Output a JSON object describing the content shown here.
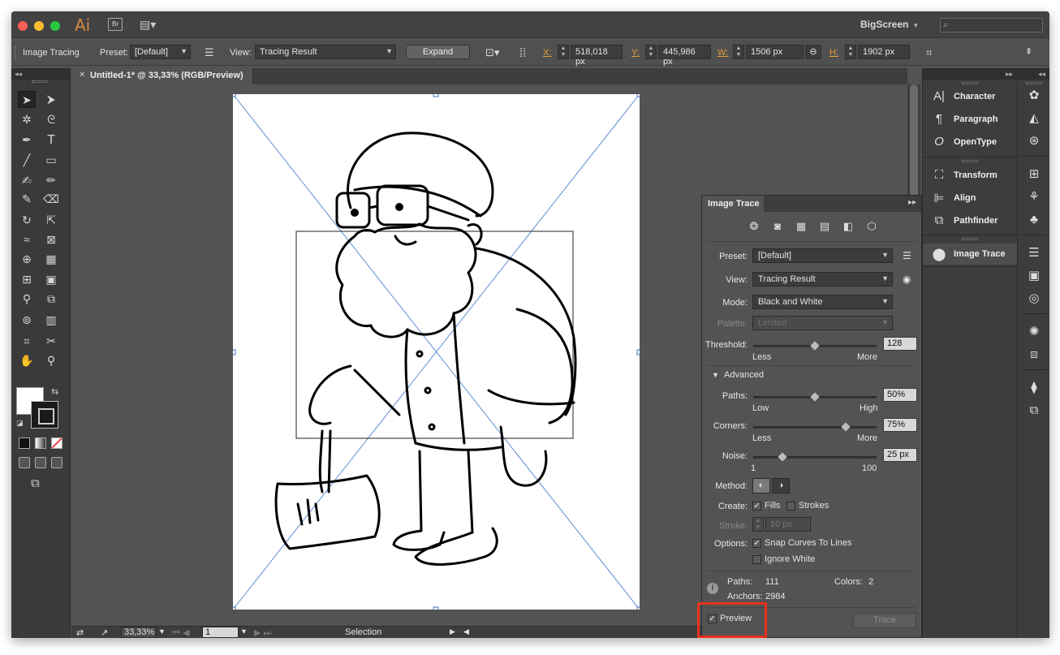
{
  "app": {
    "logo": "Ai",
    "bridge": "Br",
    "workspace": "BigScreen",
    "workspace_caret": "▾"
  },
  "control_bar": {
    "label": "Image Tracing",
    "preset_label": "Preset:",
    "preset_value": "[Default]",
    "view_label": "View:",
    "view_value": "Tracing Result",
    "expand_button": "Expand",
    "x_label": "X:",
    "x_value": "518,018 px",
    "y_label": "Y:",
    "y_value": "445,986 px",
    "w_label": "W:",
    "w_value": "1506 px",
    "h_label": "H:",
    "h_value": "1902 px"
  },
  "document": {
    "tab_title": "Untitled-1* @ 33,33% (RGB/Preview)"
  },
  "status_bar": {
    "zoom": "33,33%",
    "page": "1",
    "status": "Selection"
  },
  "image_trace": {
    "title": "Image Trace",
    "preset": {
      "label": "Preset:",
      "value": "[Default]"
    },
    "view": {
      "label": "View:",
      "value": "Tracing Result"
    },
    "mode": {
      "label": "Mode:",
      "value": "Black and White"
    },
    "palette": {
      "label": "Palette:",
      "value": "Limited"
    },
    "threshold": {
      "label": "Threshold:",
      "value": "128",
      "min_label": "Less",
      "max_label": "More",
      "fraction": 0.5
    },
    "advanced_label": "Advanced",
    "paths": {
      "label": "Paths:",
      "value": "50%",
      "min_label": "Low",
      "max_label": "High",
      "fraction": 0.5
    },
    "corners": {
      "label": "Corners:",
      "value": "75%",
      "min_label": "Less",
      "max_label": "More",
      "fraction": 0.75
    },
    "noise": {
      "label": "Noise:",
      "value": "25 px",
      "min_label": "1",
      "max_label": "100",
      "fraction": 0.24
    },
    "method_label": "Method:",
    "create": {
      "label": "Create:",
      "fills": "Fills",
      "strokes": "Strokes",
      "fills_checked": true,
      "strokes_checked": false
    },
    "stroke": {
      "label": "Stroke:",
      "value": "10 px"
    },
    "options": {
      "label": "Options:",
      "snap": "Snap Curves To Lines",
      "ignore_white": "Ignore White",
      "snap_checked": true,
      "ignore_checked": false
    },
    "stats": {
      "paths_label": "Paths:",
      "paths_value": "111",
      "colors_label": "Colors:",
      "colors_value": "2",
      "anchors_label": "Anchors:",
      "anchors_value": "2984"
    },
    "preview": {
      "label": "Preview",
      "checked": true
    },
    "trace_button": "Trace"
  },
  "dock": {
    "group1": [
      {
        "label": "Character",
        "icon": "character-icon"
      },
      {
        "label": "Paragraph",
        "icon": "paragraph-icon"
      },
      {
        "label": "OpenType",
        "icon": "opentype-icon"
      }
    ],
    "group2": [
      {
        "label": "Transform",
        "icon": "transform-icon"
      },
      {
        "label": "Align",
        "icon": "align-icon"
      },
      {
        "label": "Pathfinder",
        "icon": "pathfinder-icon"
      }
    ],
    "group3": [
      {
        "label": "Image Trace",
        "icon": "image-trace-icon"
      }
    ]
  },
  "colors": {
    "accent_orange": "#e8a23a",
    "highlight_red": "#e5321b",
    "canvas_bg": "#535353",
    "panel_bg": "#3d3d3d",
    "selection_blue": "#3a73c8"
  }
}
